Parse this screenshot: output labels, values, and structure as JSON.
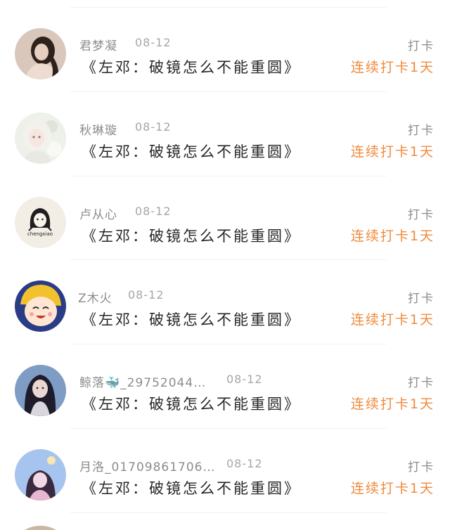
{
  "checkins": [
    {
      "name": "君梦凝",
      "date": "08-12",
      "title": "《左邓：破镜怎么不能重圆》",
      "tag": "打卡",
      "streak": "连续打卡1天",
      "avatar_icon": "avatar-photo-girl-dark",
      "avatar_colors": [
        "#d9c9bc",
        "#3b2a24",
        "#e8d4c8"
      ]
    },
    {
      "name": "秋琳璇",
      "date": "08-12",
      "title": "《左邓：破镜怎么不能重圆》",
      "tag": "打卡",
      "streak": "连续打卡1天",
      "avatar_icon": "avatar-anime-white-hair",
      "avatar_colors": [
        "#eef0ea",
        "#c9cfc2",
        "#f7f4ef"
      ]
    },
    {
      "name": "卢从心",
      "date": "08-12",
      "title": "《左邓：破镜怎么不能重圆》",
      "tag": "打卡",
      "streak": "连续打卡1天",
      "avatar_icon": "avatar-sketch-chengxiao",
      "avatar_text": "chengxiao",
      "avatar_colors": [
        "#f5f1e9",
        "#222222",
        "#efe7da"
      ]
    },
    {
      "name": "Z木火",
      "date": "08-12",
      "title": "《左邓：破镜怎么不能重圆》",
      "tag": "打卡",
      "streak": "连续打卡1天",
      "avatar_icon": "avatar-cartoon-yellow-hat",
      "avatar_colors": [
        "#2c3e8a",
        "#f4c430",
        "#ffe7d6"
      ]
    },
    {
      "name": "鲸落🐳_29752044…",
      "date": "08-12",
      "title": "《左邓：破镜怎么不能重圆》",
      "tag": "打卡",
      "streak": "连续打卡1天",
      "avatar_icon": "avatar-photo-girl-blue",
      "avatar_colors": [
        "#6f8db8",
        "#1f1f2e",
        "#e9d6d0"
      ]
    },
    {
      "name": "月洛_01709861706…",
      "date": "08-12",
      "title": "《左邓：破镜怎么不能重圆》",
      "tag": "打卡",
      "streak": "连续打卡1天",
      "avatar_icon": "avatar-illustration-sky",
      "avatar_colors": [
        "#a9c6f0",
        "#3a2a3f",
        "#f2d7e6"
      ]
    }
  ]
}
